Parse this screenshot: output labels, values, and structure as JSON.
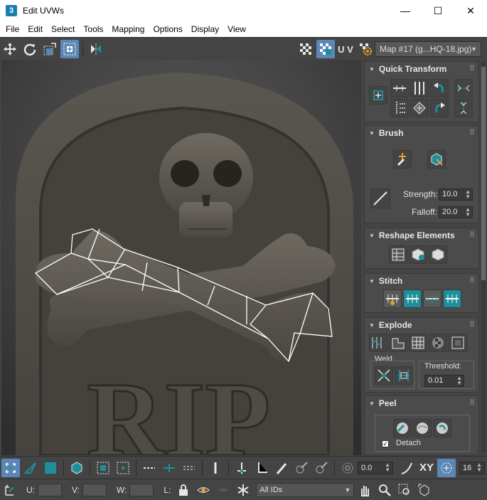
{
  "window": {
    "app_icon": "3",
    "title": "Edit UVWs",
    "minimize": "—",
    "maximize": "☐",
    "close": "✕"
  },
  "menu": [
    "File",
    "Edit",
    "Select",
    "Tools",
    "Mapping",
    "Options",
    "Display",
    "View"
  ],
  "toolbar": {
    "uv_label": "U V",
    "map_select": "Map #17 (g...HQ-18.jpg)"
  },
  "panel": {
    "quick_transform": {
      "title": "Quick Transform"
    },
    "brush": {
      "title": "Brush",
      "strength_label": "Strength:",
      "strength_value": "10.0",
      "falloff_label": "Falloff:",
      "falloff_value": "20.0"
    },
    "reshape": {
      "title": "Reshape Elements"
    },
    "stitch": {
      "title": "Stitch"
    },
    "explode": {
      "title": "Explode",
      "weld_label": "Weld",
      "threshold_label": "Threshold:",
      "threshold_value": "0.01"
    },
    "peel": {
      "title": "Peel",
      "detach_label": "Detach"
    }
  },
  "bottom": {
    "angle_value": "0.0",
    "xy_label": "XY",
    "grid_value": "16",
    "u_label": "U:",
    "v_label": "V:",
    "w_label": "W:",
    "l_label": "L:",
    "ids_select": "All IDs"
  },
  "viewport": {
    "stone_text": "RIP"
  },
  "colors": {
    "accent": "#5b87b7",
    "teal": "#1e8f9a",
    "orange": "#e8a020",
    "bg": "#444444"
  }
}
